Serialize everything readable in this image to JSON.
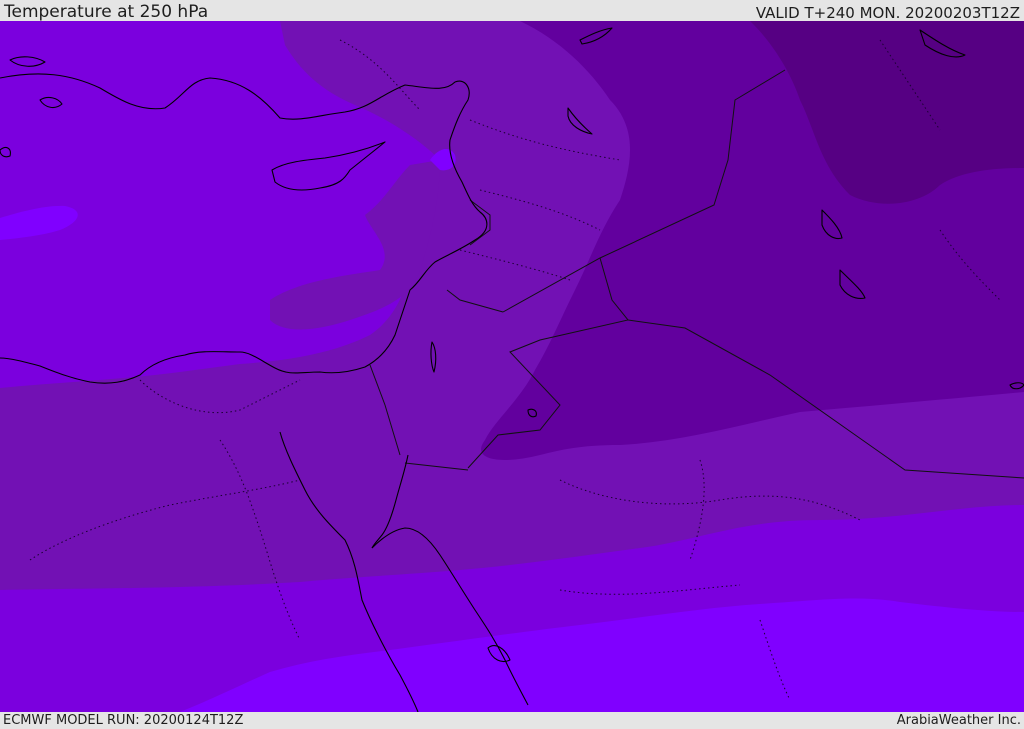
{
  "header": {
    "title": "Temperature at 250 hPa",
    "valid": "VALID T+240 MON. 20200203T12Z"
  },
  "footer": {
    "model_run": "ECMWF MODEL RUN: 20200124T12Z",
    "credit": "ArabiaWeather Inc."
  },
  "map": {
    "field": "temperature-250hPa",
    "colors": {
      "darkest": "#560083",
      "dark": "#62009e",
      "mid": "#7211b4",
      "base": "#7b00de",
      "light": "#8000ff",
      "lightest": "#8000ff",
      "coast": "#000000",
      "border": "#1a0030"
    }
  }
}
